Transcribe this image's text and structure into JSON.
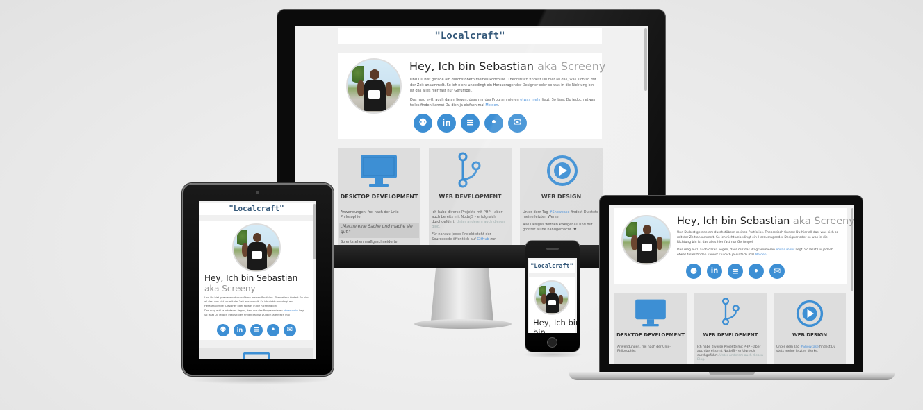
{
  "site": {
    "title": "\"Localcraft\"",
    "name": "Hey, Ich bin Sebastian",
    "alias": "aka Screeny",
    "intro_1": "Und Du bist gerade am durchstöbern meines Portfolios. Theoretisch findest Du hier all das, was sich so mit der Zeit ansammelt. So ich nicht unbedingt ein Herausragender Designer oder so was in die Richtung bin ist das alles hier fast nur Gerümpel.",
    "intro_1_short": "Und Du bist gerade am durchstöbern meines Portfolios. Theoretisch findest Du hier all das, was sich so mit der Zeit ansammelt. So ich nicht unbedingt ein Herausragender Designer oder so was in die Richtung bin.",
    "intro_2a": "Das mag evtl. auch daran liegen, dass mir das Programmieren",
    "intro_2_hl": "etwas mehr",
    "intro_2b": "liegt. So lässt Du jedoch etwas tolles finden kannst Du dich ja einfach mal",
    "intro_2_link": "Melden",
    "social_icons": [
      "github-icon",
      "linkedin-icon",
      "stackoverflow-icon",
      "twitter-icon",
      "mail-icon"
    ],
    "social_glyphs": [
      "⚉",
      "in",
      "≡",
      "•",
      "✉"
    ]
  },
  "services": [
    {
      "icon": "monitor-icon",
      "title": "DESKTOP DEVELOPMENT",
      "text_1": "Anwendungen, frei nach der Unix-Philosophie:",
      "quote": "„Mache eine Sache und mache sie gut.\"",
      "text_2": "So entstehen maßgeschneiderte"
    },
    {
      "icon": "git-branch-icon",
      "title": "WEB DEVELOPMENT",
      "text_1": "Ich habe diverse Projekte mit PHP – aber auch bereits mit NodeJS – erfolgreich durchgeführt.",
      "text_hl": "Unter anderem auch diesen Blog.",
      "text_2": "Für nahezu jedes Projekt steht der Sourcecode öffentlich auf",
      "link": "GitHub",
      "text_3": "zur"
    },
    {
      "icon": "design-icon",
      "title": "WEB DESIGN",
      "text_1": "Unter dem Tag",
      "tag": "#Showcase",
      "text_2": "findest Du stets meine letzten Werke.",
      "text_3": "Alle Designs werden Pixelgenau und mit größter Mühe handgemacht. ♥"
    }
  ],
  "phone": {
    "name_short": "Hey, Ich bin"
  }
}
